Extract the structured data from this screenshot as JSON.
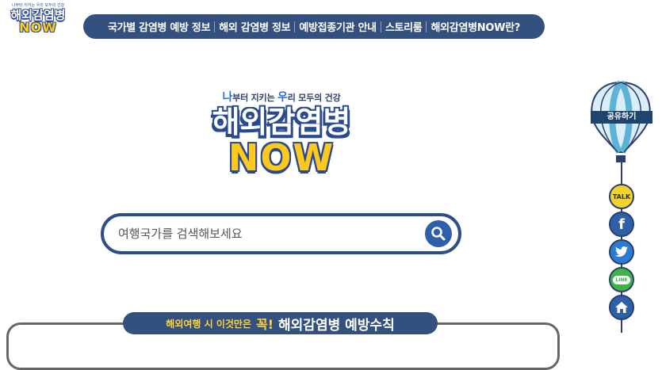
{
  "small_logo": {
    "tagline": "나부터 지키는 우리 모두의 건강",
    "title_line1": "해외감염병",
    "title_line2": "NOW"
  },
  "nav": {
    "items": [
      {
        "label": "국가별 감염병 예방 정보"
      },
      {
        "label": "해외 감염병 정보"
      },
      {
        "label": "예방접종기관 안내"
      },
      {
        "label": "스토리룸"
      },
      {
        "label": "해외감염병NOW란?"
      }
    ]
  },
  "hero": {
    "slogan_parts": [
      "나",
      "부터 지키는 ",
      "우",
      "리 모두의 건강"
    ],
    "title_line1": "해외감염병",
    "title_line2": "NOW"
  },
  "search": {
    "placeholder": "여행국가를 검색해보세요"
  },
  "rules": {
    "prefix": "해외여행 시 이것만은",
    "emphasis": "꼭!",
    "title": "해외감염병 예방수칙"
  },
  "share": {
    "label": "공유하기",
    "buttons": [
      {
        "name": "kakaotalk",
        "text": "TALK",
        "color": "#f4d22a"
      },
      {
        "name": "facebook",
        "text": "f",
        "color": "#2f5fa8"
      },
      {
        "name": "twitter",
        "text": "",
        "color": "#2a7dd0"
      },
      {
        "name": "line",
        "text": "LINE",
        "color": "#3db34a"
      },
      {
        "name": "home",
        "text": "",
        "color": "#2f5fa8"
      }
    ]
  },
  "colors": {
    "navy": "#34507e",
    "yellow": "#ffc81e",
    "blue": "#2e5fa8"
  }
}
